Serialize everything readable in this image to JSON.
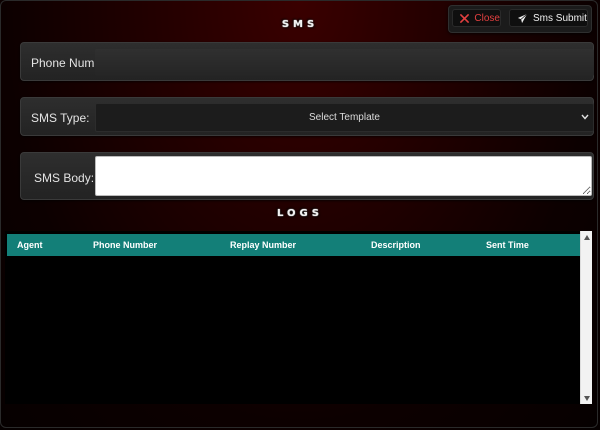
{
  "header": {
    "title": "SMS",
    "close_label": "Close",
    "submit_label": "Sms Submit",
    "close_icon": "close-icon",
    "submit_icon": "paper-plane-icon"
  },
  "form": {
    "phone": {
      "label": "Phone Num:",
      "value": ""
    },
    "sms_type": {
      "label": "SMS Type:",
      "selected": "Select Template"
    },
    "sms_body": {
      "label": "SMS Body:",
      "value": ""
    }
  },
  "logs": {
    "title": "LOGS",
    "columns": [
      "Agent",
      "Phone Number",
      "Replay Number",
      "Description",
      "Sent Time"
    ],
    "rows": []
  },
  "colors": {
    "accent_teal": "#137f78",
    "close_red": "#e34040",
    "background_dark_red": "#3a0000"
  }
}
